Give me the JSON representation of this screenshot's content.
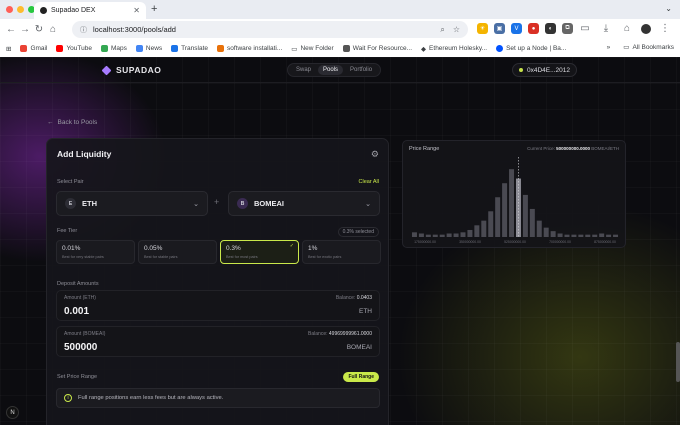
{
  "browser": {
    "tab_title": "Supadao DEX",
    "url": "localhost:3000/pools/add",
    "bookmarks": [
      "Gmail",
      "YouTube",
      "Maps",
      "News",
      "Translate",
      "software installati...",
      "New Folder",
      "Wait For Resource...",
      "Ethereum Holesky...",
      "Set up a Node | Ba..."
    ],
    "all_bookmarks": "All Bookmarks"
  },
  "app": {
    "brand": "SUPADAO",
    "nav": [
      {
        "label": "Swap",
        "active": false
      },
      {
        "label": "Pools",
        "active": true
      },
      {
        "label": "Portfolio",
        "active": false
      }
    ],
    "wallet": "0x4D4E...2012"
  },
  "back_link": "Back to Pools",
  "panel": {
    "title": "Add Liquidity",
    "select_pair_label": "Select Pair",
    "clear_all": "Clear All",
    "token_a": {
      "symbol": "ETH",
      "badge": "E"
    },
    "token_b": {
      "symbol": "BOMEAI",
      "badge": "B"
    },
    "fee_tier_label": "Fee Tier",
    "fee_selected_note": "0.3% selected",
    "fee_tiers": [
      {
        "value": "0.01%",
        "desc": "Best for very stable pairs",
        "active": false
      },
      {
        "value": "0.05%",
        "desc": "Best for stable pairs",
        "active": false
      },
      {
        "value": "0.3%",
        "desc": "Best for most pairs",
        "active": true
      },
      {
        "value": "1%",
        "desc": "Best for exotic pairs",
        "active": false
      }
    ],
    "deposit_label": "Deposit Amounts",
    "amount_a": {
      "label": "Amount (ETH)",
      "value": "0.001",
      "balance_label": "Balance:",
      "balance": "0.0403",
      "symbol": "ETH"
    },
    "amount_b": {
      "label": "Amount (BOMEAI)",
      "value": "500000",
      "balance_label": "Balance:",
      "balance": "49969999961.0000",
      "symbol": "BOMEAI"
    },
    "price_range_label": "Set Price Range",
    "full_range_button": "Full Range",
    "info_text": "Full range positions earn less fees but are always active."
  },
  "price_chart": {
    "title": "Price Range",
    "current_price_label": "Current Price:",
    "current_price": "500000000.0000",
    "pair_unit": "BOMEAI/ETH"
  },
  "chart_data": {
    "type": "bar",
    "title": "Price Range",
    "values": [
      4,
      3,
      2,
      2,
      2,
      3,
      3,
      4,
      6,
      10,
      14,
      22,
      34,
      46,
      58,
      50,
      36,
      24,
      14,
      8,
      5,
      3,
      2,
      2,
      2,
      2,
      2,
      3,
      2,
      2
    ],
    "current_index": 15,
    "x_tick_labels": [
      "175000000.00",
      "350000000.00",
      "525000000.00",
      "700000000.00",
      "875000000.00"
    ],
    "ylim": [
      0,
      65
    ]
  },
  "colors": {
    "accent": "#c9e84a",
    "brand": "#a77bff"
  }
}
